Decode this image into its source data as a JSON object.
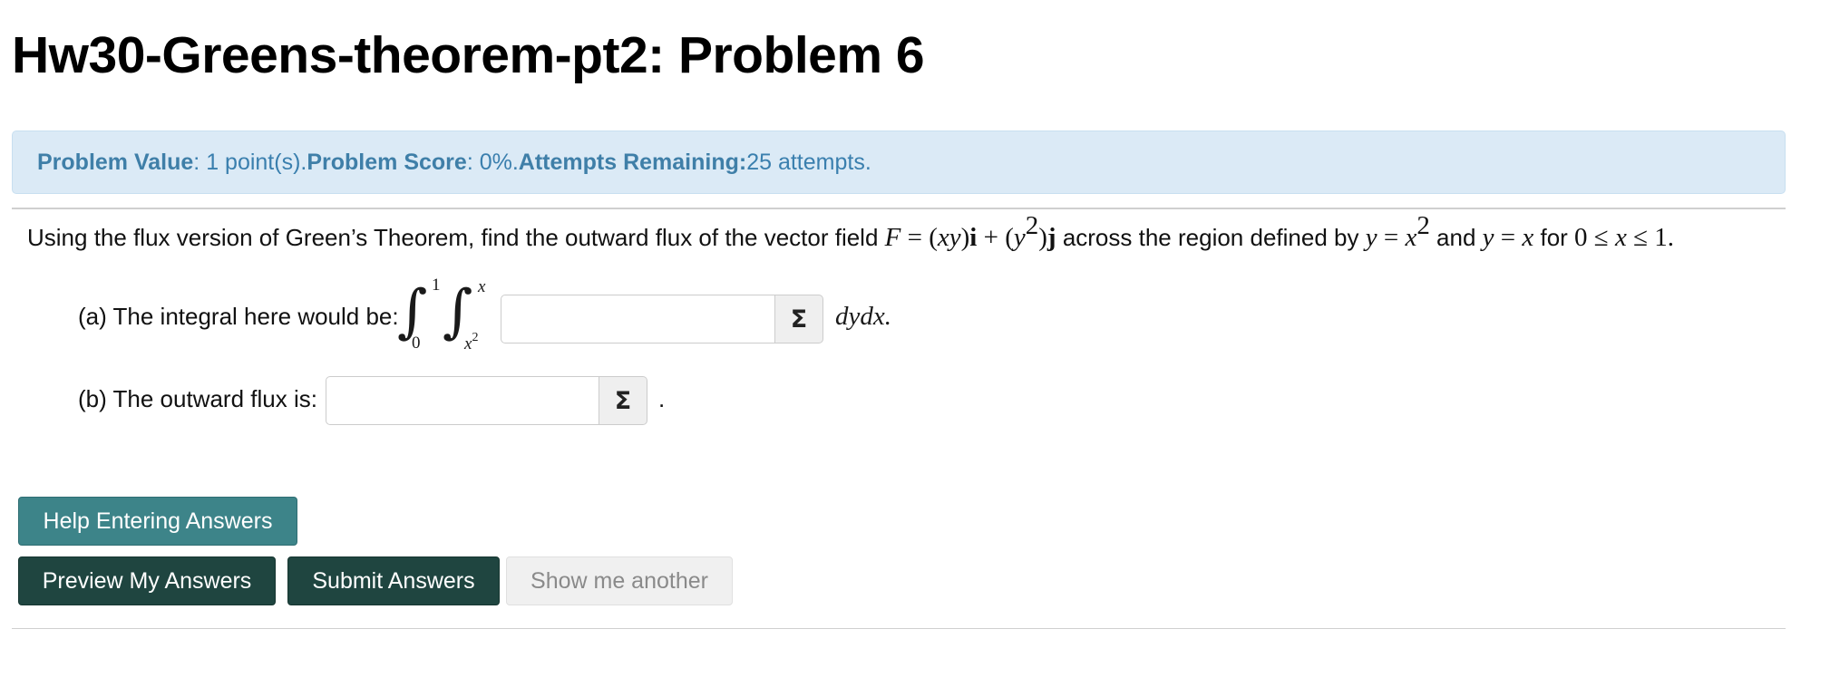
{
  "page": {
    "title": "Hw30-Greens-theorem-pt2: Problem 6"
  },
  "info": {
    "value_label": "Problem Value",
    "value_text": ": 1 point(s). ",
    "score_label": "Problem Score",
    "score_text": ": 0%. ",
    "attempts_label": "Attempts Remaining:",
    "attempts_text": " 25 attempts."
  },
  "problem": {
    "intro": "Using the flux version of Green’s Theorem, find the outward flux of the vector field ",
    "field_F": "F",
    "field_eq": " = (",
    "field_xy": "xy",
    "field_i_open": ")",
    "field_i": "i",
    "field_plus": " + (",
    "field_y": "y",
    "field_y_exp": "2",
    "field_j_open": ")",
    "field_j": "j",
    "middle": " across the region defined by ",
    "curve1_y": "y",
    "curve1_eq": " = ",
    "curve1_x": "x",
    "curve1_exp": "2",
    "and": " and ",
    "curve2_y": "y",
    "curve2_eq": " = ",
    "curve2_x": "x",
    "for": " for ",
    "range_low": "0 ≤ ",
    "range_x": "x",
    "range_high": " ≤ 1."
  },
  "part_a": {
    "label": "(a) The integral here would be:",
    "outer_upper": "1",
    "outer_lower": "0",
    "inner_upper": "x",
    "inner_lower_base": "x",
    "inner_lower_exp": "2",
    "input_value": "",
    "sigma": "Σ",
    "after": "dydx."
  },
  "part_b": {
    "label": "(b) The outward flux is:",
    "input_value": "",
    "sigma": "Σ",
    "after": "."
  },
  "buttons": {
    "help": "Help Entering Answers",
    "preview": "Preview My Answers",
    "submit": "Submit Answers",
    "another": "Show me another"
  }
}
